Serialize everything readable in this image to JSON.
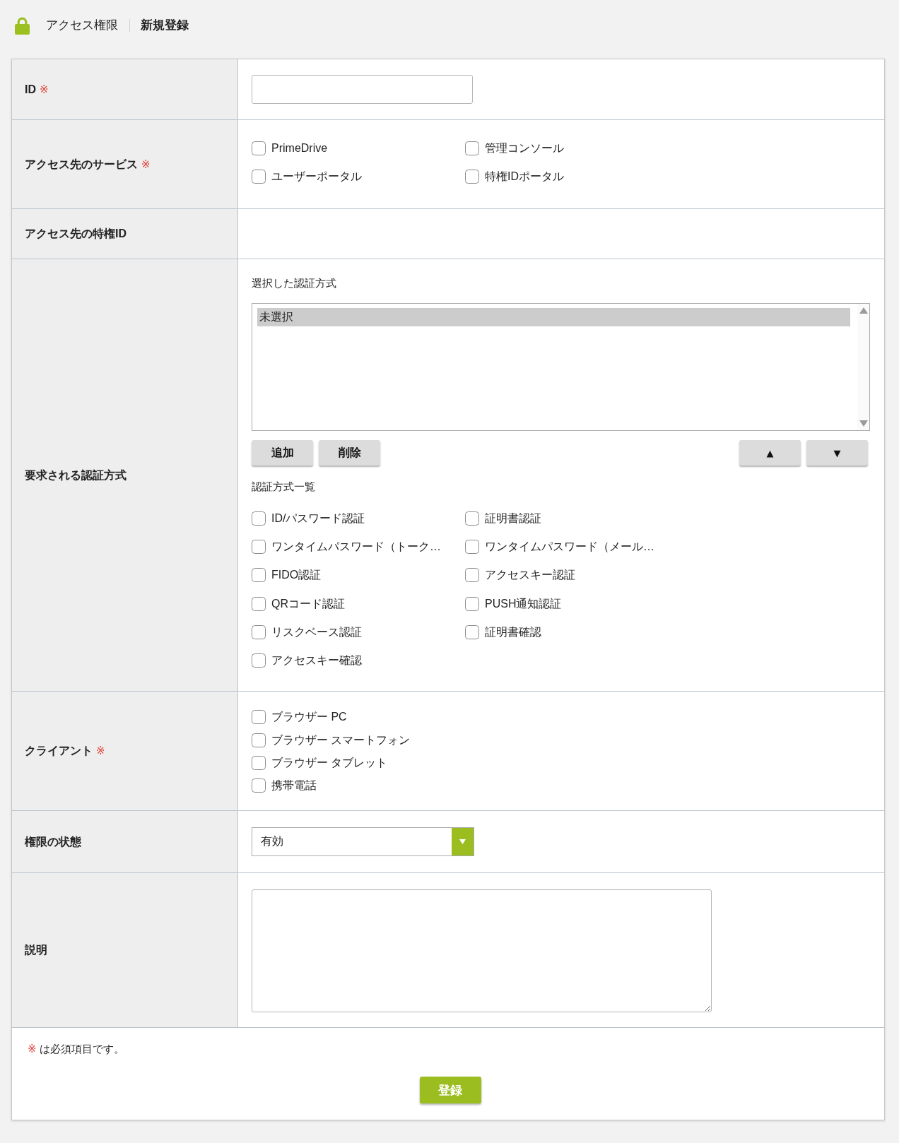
{
  "header": {
    "section": "アクセス権限",
    "page": "新規登録"
  },
  "form": {
    "rows": [
      {
        "kind": "input",
        "label": "ID",
        "required_mark": "※"
      },
      {
        "kind": "checkbox_grid",
        "label": "アクセス先のサービス",
        "required_mark": "※",
        "options": [
          {
            "label": "PrimeDrive",
            "checked": false
          },
          {
            "label": "管理コンソール",
            "checked": false
          },
          {
            "label": "ユーザーポータル",
            "checked": false
          },
          {
            "label": "特権IDポータル",
            "checked": false
          }
        ]
      },
      {
        "kind": "empty",
        "label": "アクセス先の特権ID"
      },
      {
        "kind": "auth_methods",
        "label": "要求される認証方式",
        "selected_title": "選択した認証方式",
        "selected_options": [
          {
            "label": "未選択",
            "selected": true
          }
        ],
        "action_buttons": [
          "追加",
          "削除"
        ],
        "order_buttons": [
          "▲",
          "▼"
        ],
        "list_title": "認証方式一覧",
        "options": [
          {
            "label": "ID/パスワード認証",
            "checked": false
          },
          {
            "label": "証明書認証",
            "checked": false
          },
          {
            "label": "ワンタイムパスワード（トーク…",
            "checked": false
          },
          {
            "label": "ワンタイムパスワード（メール…",
            "checked": false
          },
          {
            "label": "FIDO認証",
            "checked": false
          },
          {
            "label": "アクセスキー認証",
            "checked": false
          },
          {
            "label": "QRコード認証",
            "checked": false
          },
          {
            "label": "PUSH通知認証",
            "checked": false
          },
          {
            "label": "リスクベース認証",
            "checked": false
          },
          {
            "label": "証明書確認",
            "checked": false
          },
          {
            "label": "アクセスキー確認",
            "checked": false
          }
        ]
      },
      {
        "kind": "checkbox_list",
        "label": "クライアント",
        "required_mark": "※",
        "options": [
          {
            "label": "ブラウザー PC",
            "checked": false
          },
          {
            "label": "ブラウザー スマートフォン",
            "checked": false
          },
          {
            "label": "ブラウザー タブレット",
            "checked": false
          },
          {
            "label": "携帯電話",
            "checked": false
          }
        ]
      },
      {
        "kind": "select",
        "label": "権限の状態",
        "value": "有効"
      },
      {
        "kind": "textarea",
        "label": "説明"
      }
    ],
    "note": {
      "mark": "※",
      "text": "は必須項目です。"
    },
    "submit": "登録"
  }
}
